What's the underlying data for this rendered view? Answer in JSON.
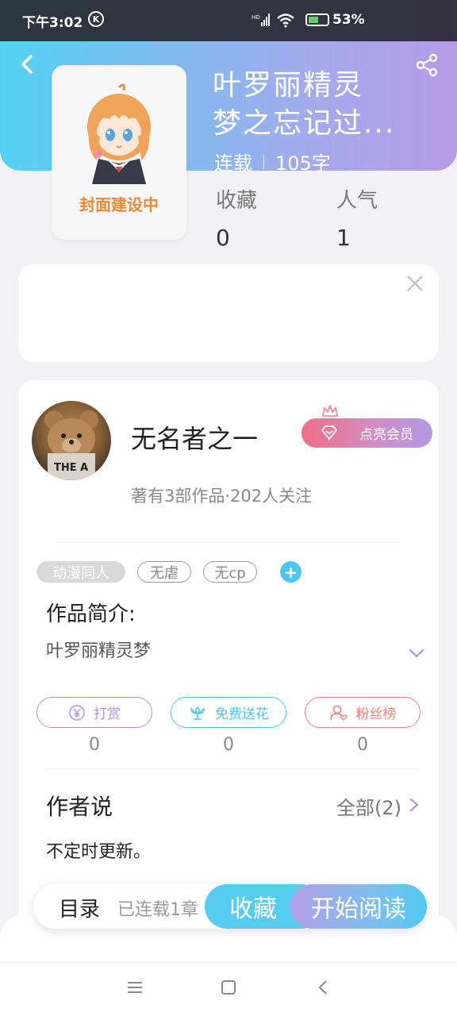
{
  "status_bar": {
    "time": "下午3:02",
    "k_icon": "K",
    "network": "HD",
    "battery_percent": "53%"
  },
  "header": {
    "back_icon": "chevron-left",
    "share_icon": "share"
  },
  "book": {
    "cover_label": "封面建设中",
    "title_line1": "叶罗丽精灵",
    "title_line2": "梦之忘记过...",
    "status": "连载",
    "word_count": "105字",
    "stats": [
      {
        "label": "收藏",
        "value": "0"
      },
      {
        "label": "人气",
        "value": "1"
      }
    ]
  },
  "author": {
    "name": "无名者之一",
    "vip_label": "点亮会员",
    "stats_text": "著有3部作品·202人关注"
  },
  "tags": [
    "动漫同人",
    "无虐",
    "无cp"
  ],
  "add_tag": "+",
  "intro": {
    "title": "作品简介:",
    "text": "叶罗丽精灵梦"
  },
  "actions": [
    {
      "label": "打赏",
      "count": "0",
      "icon": "yen-icon",
      "color": "#b48fe0"
    },
    {
      "label": "免费送花",
      "count": "0",
      "icon": "flower-icon",
      "color": "#4cc6ef"
    },
    {
      "label": "粉丝榜",
      "count": "0",
      "icon": "fan-icon",
      "color": "#ef7f7f"
    }
  ],
  "author_says": {
    "title": "作者说",
    "all_label": "全部(2)",
    "text": "不定时更新。"
  },
  "bottom_bar": {
    "toc_label": "目录",
    "toc_status": "已连载1章",
    "collect_label": "收藏",
    "read_label": "开始阅读"
  },
  "colors": {
    "header_gradient_start": "#55d2f3",
    "header_gradient_end": "#b79ae6",
    "accent_blue": "#55ccf0",
    "accent_purple": "#b39ee6"
  }
}
